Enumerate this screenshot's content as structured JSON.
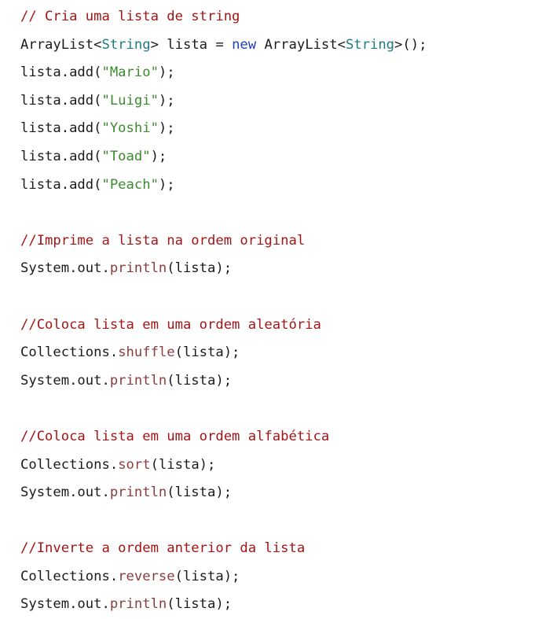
{
  "code_lines": [
    [
      {
        "t": "// Cria uma lista de string",
        "k": "comment"
      }
    ],
    [
      {
        "t": "ArrayList<",
        "k": "plain"
      },
      {
        "t": "String",
        "k": "type"
      },
      {
        "t": "> lista = ",
        "k": "plain"
      },
      {
        "t": "new",
        "k": "keyword"
      },
      {
        "t": " ArrayList<",
        "k": "plain"
      },
      {
        "t": "String",
        "k": "type"
      },
      {
        "t": ">();",
        "k": "plain"
      }
    ],
    [
      {
        "t": "lista.add(",
        "k": "plain"
      },
      {
        "t": "\"Mario\"",
        "k": "string"
      },
      {
        "t": ");",
        "k": "plain"
      }
    ],
    [
      {
        "t": "lista.add(",
        "k": "plain"
      },
      {
        "t": "\"Luigi\"",
        "k": "string"
      },
      {
        "t": ");",
        "k": "plain"
      }
    ],
    [
      {
        "t": "lista.add(",
        "k": "plain"
      },
      {
        "t": "\"Yoshi\"",
        "k": "string"
      },
      {
        "t": ");",
        "k": "plain"
      }
    ],
    [
      {
        "t": "lista.add(",
        "k": "plain"
      },
      {
        "t": "\"Toad\"",
        "k": "string"
      },
      {
        "t": ");",
        "k": "plain"
      }
    ],
    [
      {
        "t": "lista.add(",
        "k": "plain"
      },
      {
        "t": "\"Peach\"",
        "k": "string"
      },
      {
        "t": ");",
        "k": "plain"
      }
    ],
    [],
    [
      {
        "t": "//Imprime a lista na ordem original",
        "k": "comment"
      }
    ],
    [
      {
        "t": "System.out.",
        "k": "plain"
      },
      {
        "t": "println",
        "k": "method"
      },
      {
        "t": "(lista);",
        "k": "plain"
      }
    ],
    [],
    [
      {
        "t": "//Coloca lista em uma ordem aleatória",
        "k": "comment"
      }
    ],
    [
      {
        "t": "Collections.",
        "k": "plain"
      },
      {
        "t": "shuffle",
        "k": "method"
      },
      {
        "t": "(lista);",
        "k": "plain"
      }
    ],
    [
      {
        "t": "System.out.",
        "k": "plain"
      },
      {
        "t": "println",
        "k": "method"
      },
      {
        "t": "(lista);",
        "k": "plain"
      }
    ],
    [],
    [
      {
        "t": "//Coloca lista em uma ordem alfabética",
        "k": "comment"
      }
    ],
    [
      {
        "t": "Collections.",
        "k": "plain"
      },
      {
        "t": "sort",
        "k": "method"
      },
      {
        "t": "(lista);",
        "k": "plain"
      }
    ],
    [
      {
        "t": "System.out.",
        "k": "plain"
      },
      {
        "t": "println",
        "k": "method"
      },
      {
        "t": "(lista);",
        "k": "plain"
      }
    ],
    [],
    [
      {
        "t": "//Inverte a ordem anterior da lista",
        "k": "comment"
      }
    ],
    [
      {
        "t": "Collections.",
        "k": "plain"
      },
      {
        "t": "reverse",
        "k": "method"
      },
      {
        "t": "(lista);",
        "k": "plain"
      }
    ],
    [
      {
        "t": "System.out.",
        "k": "plain"
      },
      {
        "t": "println",
        "k": "method"
      },
      {
        "t": "(lista);",
        "k": "plain"
      }
    ]
  ]
}
